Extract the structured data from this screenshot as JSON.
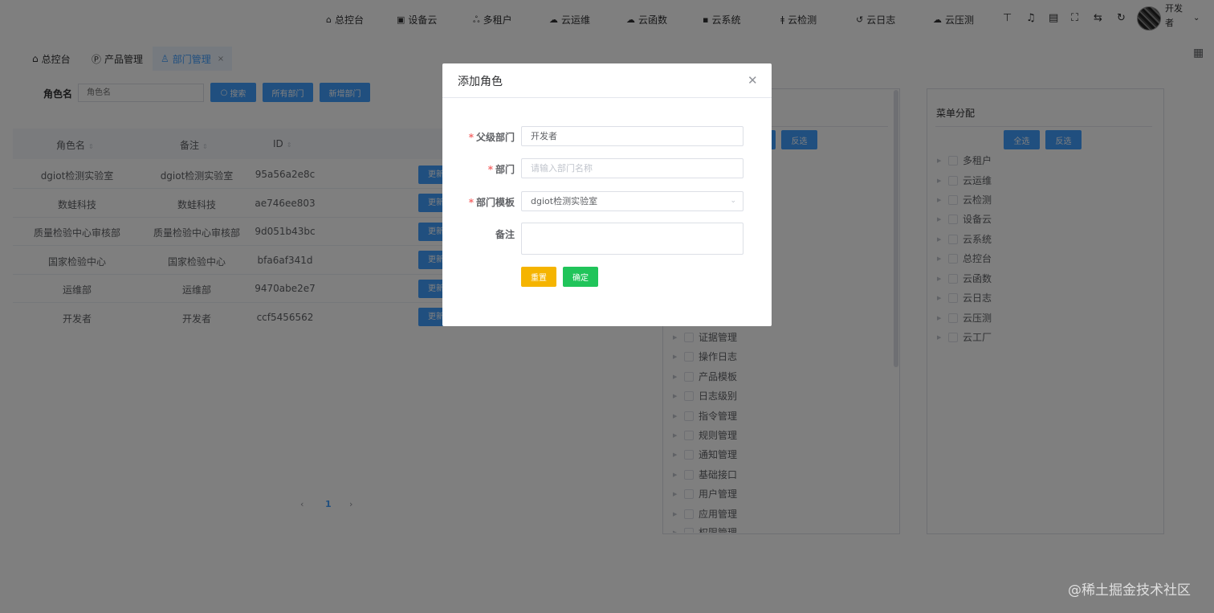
{
  "nav": {
    "items": [
      {
        "label": "总控台",
        "icon": "home-icon"
      },
      {
        "label": "设备云",
        "icon": "device-icon"
      },
      {
        "label": "多租户",
        "icon": "users-icon"
      },
      {
        "label": "云运维",
        "icon": "cloud-icon"
      },
      {
        "label": "云函数",
        "icon": "cloud-function-icon"
      },
      {
        "label": "云系统",
        "icon": "system-icon"
      },
      {
        "label": "云检测",
        "icon": "thermometer-icon"
      },
      {
        "label": "云日志",
        "icon": "log-icon"
      },
      {
        "label": "云压测",
        "icon": "cloud-test-icon"
      }
    ],
    "username": "开发者"
  },
  "tabs": [
    {
      "label": "总控台",
      "icon": "home-icon"
    },
    {
      "label": "产品管理",
      "icon": "product-icon"
    },
    {
      "label": "部门管理",
      "icon": "user-icon",
      "active": true
    }
  ],
  "filter": {
    "label": "角色名",
    "placeholder": "角色名",
    "search_btn": "搜索",
    "all_btn": "所有部门",
    "add_btn": "新增部门"
  },
  "table": {
    "columns": [
      "角色名",
      "备注",
      "ID"
    ],
    "rows": [
      {
        "name": "dgiot检测实验室",
        "remark": "dgiot检测实验室",
        "id": "95a56a2e8c",
        "action": "更新"
      },
      {
        "name": "数蛙科技",
        "remark": "数蛙科技",
        "id": "ae746ee803",
        "action": "更新"
      },
      {
        "name": "质量检验中心审核部",
        "remark": "质量检验中心审核部",
        "id": "9d051b43bc",
        "action": "更新"
      },
      {
        "name": "国家检验中心",
        "remark": "国家检验中心",
        "id": "bfa6af341d",
        "action": "更新"
      },
      {
        "name": "运维部",
        "remark": "运维部",
        "id": "9470abe2e7",
        "action": "更新"
      },
      {
        "name": "开发者",
        "remark": "开发者",
        "id": "ccf5456562",
        "action": "更新"
      }
    ]
  },
  "pagination": {
    "prev": "‹",
    "current": "1",
    "next": "›"
  },
  "permission_panel": {
    "invert_btn": "反选",
    "items": [
      "证据管理",
      "操作日志",
      "产品模板",
      "日志级别",
      "指令管理",
      "规则管理",
      "通知管理",
      "基础接口",
      "用户管理",
      "应用管理",
      "权限管理"
    ]
  },
  "menu_panel": {
    "title": "菜单分配",
    "select_all_btn": "全选",
    "invert_btn": "反选",
    "items": [
      "多租户",
      "云运维",
      "云检测",
      "设备云",
      "云系统",
      "总控台",
      "云函数",
      "云日志",
      "云压测",
      "云工厂"
    ]
  },
  "modal": {
    "title": "添加角色",
    "fields": {
      "parent": {
        "label": "父级部门",
        "value": "开发者"
      },
      "dept": {
        "label": "部门",
        "placeholder": "请输入部门名称"
      },
      "template": {
        "label": "部门模板",
        "value": "dgiot检测实验室"
      },
      "remark": {
        "label": "备注"
      }
    },
    "reset_btn": "重置",
    "confirm_btn": "确定"
  },
  "watermark": "@稀土掘金技术社区",
  "colors": {
    "primary": "#409eff",
    "warning": "#f5b400",
    "success": "#20c45a",
    "danger": "#f56c6c"
  }
}
